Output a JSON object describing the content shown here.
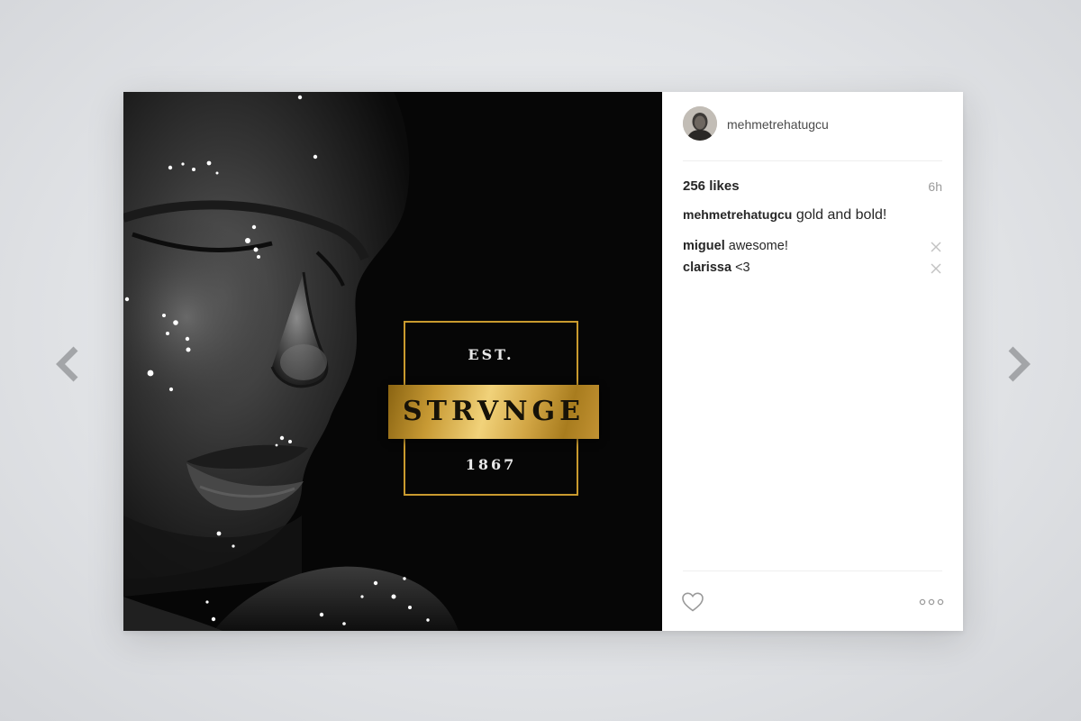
{
  "post": {
    "username": "mehmetrehatugcu",
    "likes": "256 likes",
    "time": "6h",
    "caption": {
      "username": "mehmetrehatugcu",
      "text": "gold and bold!"
    },
    "comments": [
      {
        "username": "miguel",
        "text": "awesome!"
      },
      {
        "username": "clarissa",
        "text": "<3"
      }
    ]
  },
  "media": {
    "logo": {
      "top_text": "EST.",
      "name": "STRVNGE",
      "year": "1867"
    }
  },
  "icons": {
    "previous": "chevron-left-icon",
    "next": "chevron-right-icon",
    "like": "heart-icon",
    "more": "more-options-icon",
    "delete_comment": "close-icon"
  },
  "colors": {
    "gold": "#c99a2e",
    "text_primary": "#262626",
    "text_secondary": "#9a9a9a",
    "card_background": "#ffffff",
    "media_background": "#060606"
  }
}
